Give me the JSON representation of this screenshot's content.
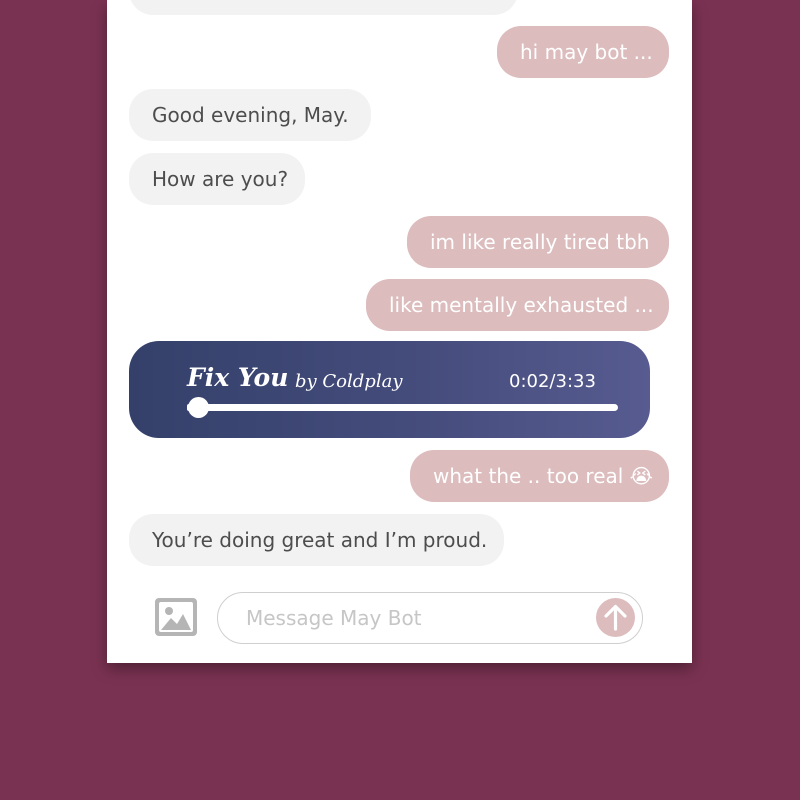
{
  "messages": [
    {
      "side": "in",
      "text": ""
    },
    {
      "side": "out",
      "text": "hi may bot ..."
    },
    {
      "side": "in",
      "text": "Good evening, May."
    },
    {
      "side": "in",
      "text": "How are you?"
    },
    {
      "side": "out",
      "text": "im like really tired tbh"
    },
    {
      "side": "out",
      "text": "like mentally exhausted ..."
    },
    {
      "side": "out",
      "text": "what the .. too real 😭"
    },
    {
      "side": "in",
      "text": "You’re doing great and I’m proud."
    }
  ],
  "music": {
    "title": "Fix You",
    "artist_line": "by Coldplay",
    "time": "0:02/3:33",
    "progress": 0.01
  },
  "composer": {
    "placeholder": "Message May Bot",
    "image_icon": "image-icon",
    "send_icon": "arrow-up-icon"
  },
  "colors": {
    "background": "#7a3252",
    "outgoing_bubble": "#dcbcbd",
    "incoming_bubble": "#f2f2f2",
    "music_card_start": "#34406a",
    "music_card_end": "#575b90"
  }
}
